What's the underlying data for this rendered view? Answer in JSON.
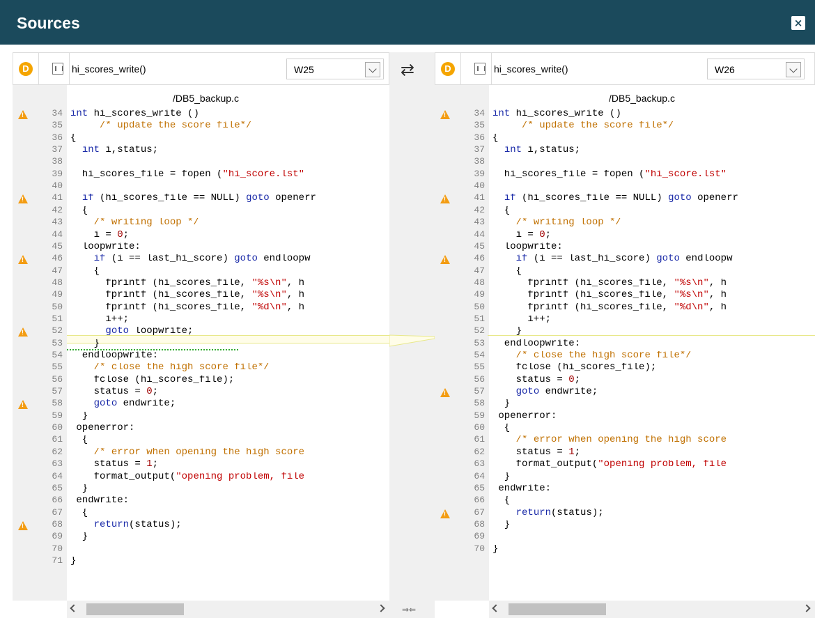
{
  "window": {
    "title": "Sources",
    "close_label": "×"
  },
  "swap_glyph": "⇄",
  "merge_glyph": "⇒⇐",
  "left": {
    "badge": "D",
    "function": "hi_scores_write()",
    "version": "W25",
    "filename": "/DB5_backup.c",
    "lines": [
      {
        "n": "34",
        "warn": true,
        "parts": [
          [
            "kw",
            "int"
          ],
          [
            "tx",
            " hi_scores_write ()"
          ]
        ]
      },
      {
        "n": "35",
        "warn": false,
        "parts": [
          [
            "cm",
            "     /* update the score file*/"
          ]
        ]
      },
      {
        "n": "36",
        "warn": false,
        "parts": [
          [
            "tx",
            "{"
          ]
        ]
      },
      {
        "n": "37",
        "warn": false,
        "parts": [
          [
            "tx",
            "  "
          ],
          [
            "kw",
            "int"
          ],
          [
            "tx",
            " i,status;"
          ]
        ]
      },
      {
        "n": "38",
        "warn": false,
        "parts": []
      },
      {
        "n": "39",
        "warn": false,
        "parts": [
          [
            "tx",
            "  hi_scores_file = fopen ("
          ],
          [
            "st",
            "\"hi_score.lst\""
          ]
        ]
      },
      {
        "n": "40",
        "warn": false,
        "parts": []
      },
      {
        "n": "41",
        "warn": true,
        "parts": [
          [
            "tx",
            "  "
          ],
          [
            "kw",
            "if"
          ],
          [
            "tx",
            " (hi_scores_file == NULL) "
          ],
          [
            "kw",
            "goto"
          ],
          [
            "tx",
            " openerr"
          ]
        ]
      },
      {
        "n": "42",
        "warn": false,
        "parts": [
          [
            "tx",
            "  {"
          ]
        ]
      },
      {
        "n": "43",
        "warn": false,
        "parts": [
          [
            "tx",
            "    "
          ],
          [
            "cm",
            "/* writing loop */"
          ]
        ]
      },
      {
        "n": "44",
        "warn": false,
        "parts": [
          [
            "tx",
            "    i = "
          ],
          [
            "nm",
            "0"
          ],
          [
            "tx",
            ";"
          ]
        ]
      },
      {
        "n": "45",
        "warn": false,
        "parts": [
          [
            "tx",
            "  loopwrite:"
          ]
        ]
      },
      {
        "n": "46",
        "warn": true,
        "parts": [
          [
            "tx",
            "    "
          ],
          [
            "kw",
            "if"
          ],
          [
            "tx",
            " (i == last_hi_score) "
          ],
          [
            "kw",
            "goto"
          ],
          [
            "tx",
            " endloopw"
          ]
        ]
      },
      {
        "n": "47",
        "warn": false,
        "parts": [
          [
            "tx",
            "    {"
          ]
        ]
      },
      {
        "n": "48",
        "warn": false,
        "parts": [
          [
            "tx",
            "      fprintf (hi_scores_file, "
          ],
          [
            "st",
            "\"%s\\n\""
          ],
          [
            "tx",
            ", h"
          ]
        ]
      },
      {
        "n": "49",
        "warn": false,
        "parts": [
          [
            "tx",
            "      fprintf (hi_scores_file, "
          ],
          [
            "st",
            "\"%s\\n\""
          ],
          [
            "tx",
            ", h"
          ]
        ]
      },
      {
        "n": "50",
        "warn": false,
        "parts": [
          [
            "tx",
            "      fprintf (hi_scores_file, "
          ],
          [
            "st",
            "\"%d\\n\""
          ],
          [
            "tx",
            ", h"
          ]
        ]
      },
      {
        "n": "51",
        "warn": false,
        "parts": [
          [
            "tx",
            "      i++;"
          ]
        ]
      },
      {
        "n": "52",
        "warn": true,
        "parts": [
          [
            "tx",
            "      "
          ],
          [
            "kw",
            "goto"
          ],
          [
            "tx",
            " loopwrite;"
          ]
        ]
      },
      {
        "n": "53",
        "warn": false,
        "parts": [
          [
            "tx",
            "    }"
          ]
        ]
      },
      {
        "n": "54",
        "warn": false,
        "parts": [
          [
            "tx",
            "  endloopwrite:"
          ]
        ]
      },
      {
        "n": "55",
        "warn": false,
        "parts": [
          [
            "tx",
            "    "
          ],
          [
            "cm",
            "/* close the high score file*/"
          ]
        ]
      },
      {
        "n": "56",
        "warn": false,
        "parts": [
          [
            "tx",
            "    fclose (hi_scores_file);"
          ]
        ]
      },
      {
        "n": "57",
        "warn": false,
        "parts": [
          [
            "tx",
            "    status = "
          ],
          [
            "nm",
            "0"
          ],
          [
            "tx",
            ";"
          ]
        ]
      },
      {
        "n": "58",
        "warn": true,
        "parts": [
          [
            "tx",
            "    "
          ],
          [
            "kw",
            "goto"
          ],
          [
            "tx",
            " endwrite;"
          ]
        ]
      },
      {
        "n": "59",
        "warn": false,
        "parts": [
          [
            "tx",
            "  }"
          ]
        ]
      },
      {
        "n": "60",
        "warn": false,
        "parts": [
          [
            "tx",
            " openerror:"
          ]
        ]
      },
      {
        "n": "61",
        "warn": false,
        "parts": [
          [
            "tx",
            "  {"
          ]
        ]
      },
      {
        "n": "62",
        "warn": false,
        "parts": [
          [
            "tx",
            "    "
          ],
          [
            "cm",
            "/* error when opening the high score"
          ]
        ]
      },
      {
        "n": "63",
        "warn": false,
        "parts": [
          [
            "tx",
            "    status = "
          ],
          [
            "nm",
            "1"
          ],
          [
            "tx",
            ";"
          ]
        ]
      },
      {
        "n": "64",
        "warn": false,
        "parts": [
          [
            "tx",
            "    format_output("
          ],
          [
            "st",
            "\"opening problem, file"
          ]
        ]
      },
      {
        "n": "65",
        "warn": false,
        "parts": [
          [
            "tx",
            "  }"
          ]
        ]
      },
      {
        "n": "66",
        "warn": false,
        "parts": [
          [
            "tx",
            " endwrite:"
          ]
        ]
      },
      {
        "n": "67",
        "warn": false,
        "parts": [
          [
            "tx",
            "  {"
          ]
        ]
      },
      {
        "n": "68",
        "warn": true,
        "parts": [
          [
            "tx",
            "    "
          ],
          [
            "kw",
            "return"
          ],
          [
            "tx",
            "(status);"
          ]
        ]
      },
      {
        "n": "69",
        "warn": false,
        "parts": [
          [
            "tx",
            "  }"
          ]
        ]
      },
      {
        "n": "70",
        "warn": false,
        "parts": []
      },
      {
        "n": "71",
        "warn": false,
        "parts": [
          [
            "tx",
            "}"
          ]
        ]
      }
    ]
  },
  "right": {
    "badge": "D",
    "function": "hi_scores_write()",
    "version": "W26",
    "filename": "/DB5_backup.c",
    "lines": [
      {
        "n": "34",
        "warn": true,
        "parts": [
          [
            "kw",
            "int"
          ],
          [
            "tx",
            " hi_scores_write ()"
          ]
        ]
      },
      {
        "n": "35",
        "warn": false,
        "parts": [
          [
            "cm",
            "     /* update the score file*/"
          ]
        ]
      },
      {
        "n": "36",
        "warn": false,
        "parts": [
          [
            "tx",
            "{"
          ]
        ]
      },
      {
        "n": "37",
        "warn": false,
        "parts": [
          [
            "tx",
            "  "
          ],
          [
            "kw",
            "int"
          ],
          [
            "tx",
            " i,status;"
          ]
        ]
      },
      {
        "n": "38",
        "warn": false,
        "parts": []
      },
      {
        "n": "39",
        "warn": false,
        "parts": [
          [
            "tx",
            "  hi_scores_file = fopen ("
          ],
          [
            "st",
            "\"hi_score.lst\""
          ]
        ]
      },
      {
        "n": "40",
        "warn": false,
        "parts": []
      },
      {
        "n": "41",
        "warn": true,
        "parts": [
          [
            "tx",
            "  "
          ],
          [
            "kw",
            "if"
          ],
          [
            "tx",
            " (hi_scores_file == NULL) "
          ],
          [
            "kw",
            "goto"
          ],
          [
            "tx",
            " openerr"
          ]
        ]
      },
      {
        "n": "42",
        "warn": false,
        "parts": [
          [
            "tx",
            "  {"
          ]
        ]
      },
      {
        "n": "43",
        "warn": false,
        "parts": [
          [
            "tx",
            "    "
          ],
          [
            "cm",
            "/* writing loop */"
          ]
        ]
      },
      {
        "n": "44",
        "warn": false,
        "parts": [
          [
            "tx",
            "    i = "
          ],
          [
            "nm",
            "0"
          ],
          [
            "tx",
            ";"
          ]
        ]
      },
      {
        "n": "45",
        "warn": false,
        "parts": [
          [
            "tx",
            "  loopwrite:"
          ]
        ]
      },
      {
        "n": "46",
        "warn": true,
        "parts": [
          [
            "tx",
            "    "
          ],
          [
            "kw",
            "if"
          ],
          [
            "tx",
            " (i == last_hi_score) "
          ],
          [
            "kw",
            "goto"
          ],
          [
            "tx",
            " endloopw"
          ]
        ]
      },
      {
        "n": "47",
        "warn": false,
        "parts": [
          [
            "tx",
            "    {"
          ]
        ]
      },
      {
        "n": "48",
        "warn": false,
        "parts": [
          [
            "tx",
            "      fprintf (hi_scores_file, "
          ],
          [
            "st",
            "\"%s\\n\""
          ],
          [
            "tx",
            ", h"
          ]
        ]
      },
      {
        "n": "49",
        "warn": false,
        "parts": [
          [
            "tx",
            "      fprintf (hi_scores_file, "
          ],
          [
            "st",
            "\"%s\\n\""
          ],
          [
            "tx",
            ", h"
          ]
        ]
      },
      {
        "n": "50",
        "warn": false,
        "parts": [
          [
            "tx",
            "      fprintf (hi_scores_file, "
          ],
          [
            "st",
            "\"%d\\n\""
          ],
          [
            "tx",
            ", h"
          ]
        ]
      },
      {
        "n": "51",
        "warn": false,
        "parts": [
          [
            "tx",
            "      i++;"
          ]
        ]
      },
      {
        "n": "52",
        "warn": false,
        "parts": [
          [
            "tx",
            "    }"
          ]
        ]
      },
      {
        "n": "53",
        "warn": false,
        "parts": [
          [
            "tx",
            "  endloopwrite:"
          ]
        ]
      },
      {
        "n": "54",
        "warn": false,
        "parts": [
          [
            "tx",
            "    "
          ],
          [
            "cm",
            "/* close the high score file*/"
          ]
        ]
      },
      {
        "n": "55",
        "warn": false,
        "parts": [
          [
            "tx",
            "    fclose (hi_scores_file);"
          ]
        ]
      },
      {
        "n": "56",
        "warn": false,
        "parts": [
          [
            "tx",
            "    status = "
          ],
          [
            "nm",
            "0"
          ],
          [
            "tx",
            ";"
          ]
        ]
      },
      {
        "n": "57",
        "warn": true,
        "parts": [
          [
            "tx",
            "    "
          ],
          [
            "kw",
            "goto"
          ],
          [
            "tx",
            " endwrite;"
          ]
        ]
      },
      {
        "n": "58",
        "warn": false,
        "parts": [
          [
            "tx",
            "  }"
          ]
        ]
      },
      {
        "n": "59",
        "warn": false,
        "parts": [
          [
            "tx",
            " openerror:"
          ]
        ]
      },
      {
        "n": "60",
        "warn": false,
        "parts": [
          [
            "tx",
            "  {"
          ]
        ]
      },
      {
        "n": "61",
        "warn": false,
        "parts": [
          [
            "tx",
            "    "
          ],
          [
            "cm",
            "/* error when opening the high score"
          ]
        ]
      },
      {
        "n": "62",
        "warn": false,
        "parts": [
          [
            "tx",
            "    status = "
          ],
          [
            "nm",
            "1"
          ],
          [
            "tx",
            ";"
          ]
        ]
      },
      {
        "n": "63",
        "warn": false,
        "parts": [
          [
            "tx",
            "    format_output("
          ],
          [
            "st",
            "\"opening problem, file"
          ]
        ]
      },
      {
        "n": "64",
        "warn": false,
        "parts": [
          [
            "tx",
            "  }"
          ]
        ]
      },
      {
        "n": "65",
        "warn": false,
        "parts": [
          [
            "tx",
            " endwrite:"
          ]
        ]
      },
      {
        "n": "66",
        "warn": false,
        "parts": [
          [
            "tx",
            "  {"
          ]
        ]
      },
      {
        "n": "67",
        "warn": true,
        "parts": [
          [
            "tx",
            "    "
          ],
          [
            "kw",
            "return"
          ],
          [
            "tx",
            "(status);"
          ]
        ]
      },
      {
        "n": "68",
        "warn": false,
        "parts": [
          [
            "tx",
            "  }"
          ]
        ]
      },
      {
        "n": "69",
        "warn": false,
        "parts": []
      },
      {
        "n": "70",
        "warn": false,
        "parts": [
          [
            "tx",
            "}"
          ]
        ]
      }
    ]
  },
  "colors": {
    "title_bar": "#1b4a5c",
    "keyword": "#1a2aa8",
    "comment": "#c07000",
    "string": "#c00000",
    "warning": "#f39c12",
    "badge": "#f5a500"
  }
}
